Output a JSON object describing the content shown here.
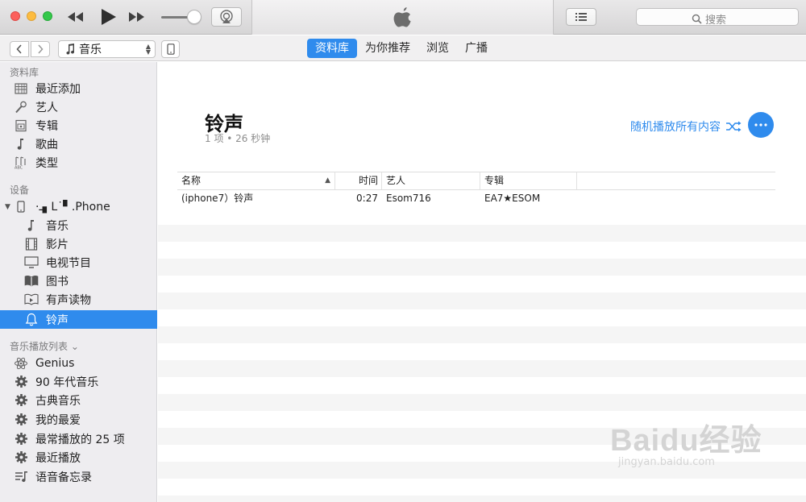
{
  "toolbar": {
    "media_kind": "音乐",
    "tabs": [
      {
        "label": "资料库",
        "active": true
      },
      {
        "label": "为你推荐",
        "active": false
      },
      {
        "label": "浏览",
        "active": false
      },
      {
        "label": "广播",
        "active": false
      }
    ]
  },
  "search": {
    "placeholder": "搜索"
  },
  "sidebar": {
    "library_header": "资料库",
    "library_items": [
      {
        "label": "最近添加",
        "icon": "grid-icon"
      },
      {
        "label": "艺人",
        "icon": "microphone-icon"
      },
      {
        "label": "专辑",
        "icon": "album-icon"
      },
      {
        "label": "歌曲",
        "icon": "music-note-icon"
      },
      {
        "label": "类型",
        "icon": "genre-icon"
      }
    ],
    "devices_header": "设备",
    "device_name": "·ـ▖L˙▘.Phone",
    "device_items": [
      {
        "label": "音乐",
        "icon": "music-note-icon"
      },
      {
        "label": "影片",
        "icon": "film-icon"
      },
      {
        "label": "电视节目",
        "icon": "tv-icon"
      },
      {
        "label": "图书",
        "icon": "book-icon"
      },
      {
        "label": "有声读物",
        "icon": "audiobook-icon"
      },
      {
        "label": "铃声",
        "icon": "bell-icon",
        "selected": true
      }
    ],
    "playlists_header": "音乐播放列表",
    "playlist_items": [
      {
        "label": "Genius",
        "icon": "genius-icon"
      },
      {
        "label": "90 年代音乐",
        "icon": "gear-icon"
      },
      {
        "label": "古典音乐",
        "icon": "gear-icon"
      },
      {
        "label": "我的最爱",
        "icon": "gear-icon"
      },
      {
        "label": "最常播放的 25 项",
        "icon": "gear-icon"
      },
      {
        "label": "最近播放",
        "icon": "gear-icon"
      },
      {
        "label": "语音备忘录",
        "icon": "voice-memo-icon"
      }
    ]
  },
  "main": {
    "title": "铃声",
    "subtitle": "1 项 • 26 秒钟",
    "shuffle_label": "随机播放所有内容",
    "columns": {
      "name": "名称",
      "time": "时间",
      "artist": "艺人",
      "album": "专辑"
    },
    "rows": [
      {
        "name": "(iphone7）铃声",
        "time": "0:27",
        "artist": "Esom716",
        "album": "EA7★ESOM"
      }
    ]
  },
  "watermark": {
    "text": "Baidu经验",
    "url": "jingyan.baidu.com"
  },
  "colors": {
    "accent": "#2f8bed",
    "sidebar_bg": "#eeedf0"
  }
}
